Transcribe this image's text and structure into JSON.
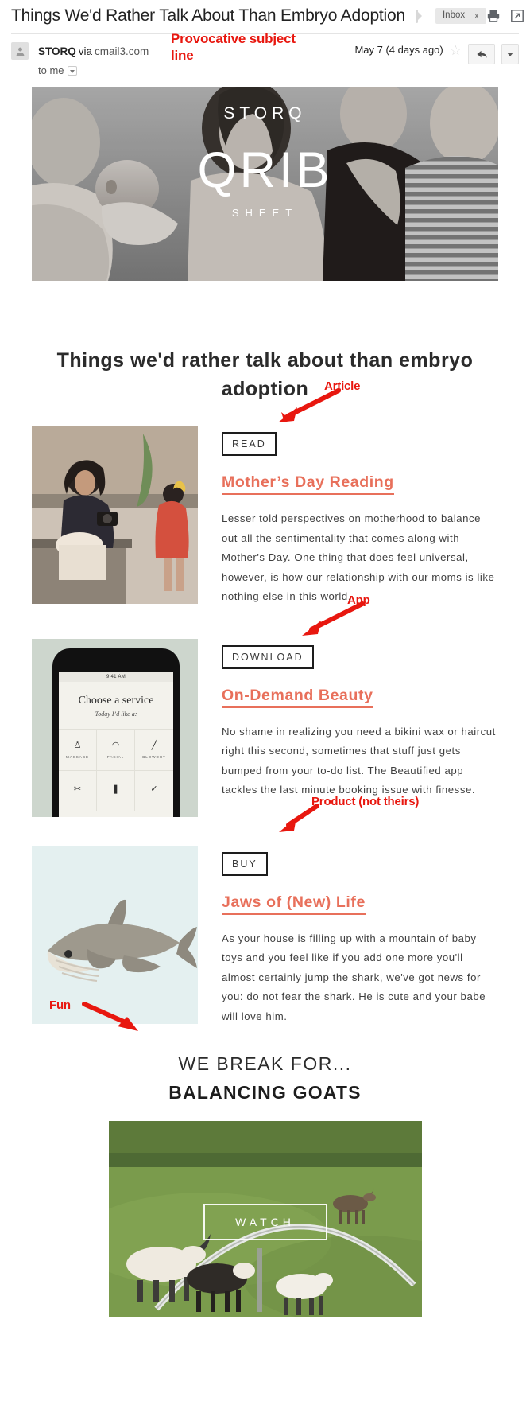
{
  "gmail": {
    "subject": "Things We'd Rather Talk About Than Embryo Adoption",
    "label_chip": "Inbox",
    "label_chip_close": "x",
    "print_icon": "print-icon",
    "popout_icon": "open-in-new-window-icon",
    "sender_name": "STORQ",
    "via_word": "via",
    "via_domain": "cmail3.com",
    "to_me": "to me",
    "date": "May 7 (4 days ago)",
    "star_glyph": "☆",
    "reply_icon": "reply-arrow-icon",
    "more_icon": "more-options-caret-icon",
    "avatar_icon": "contact-avatar-icon"
  },
  "annotations": {
    "subject": "Provocative subject line",
    "article": "Article",
    "app": "App",
    "product": "Product (not theirs)",
    "fun": "Fun",
    "color": "#e8170f"
  },
  "hero": {
    "brand": "STORQ",
    "title": "QRIB",
    "subtitle": "SHEET"
  },
  "newsletter": {
    "heading": "Things we'd rather talk about than embryo adoption",
    "accent_color": "#e8705b",
    "sections": [
      {
        "cta": "READ",
        "title": "Mother’s Day Reading",
        "text": "Lesser told perspectives on motherhood to balance out all the sentimentality that comes along with Mother's Day. One thing that does feel universal, however, is how our relationship with our moms is like nothing else in this world.",
        "thumb": "mother-and-daughter-photo"
      },
      {
        "cta": "DOWNLOAD",
        "title": "On-Demand Beauty",
        "text": "No shame in realizing you need a bikini wax or haircut right this second, sometimes that stuff just gets bumped from your to-do list. The Beautified app tackles the last minute booking issue with finesse.",
        "thumb": "iphone-app-screenshot"
      },
      {
        "cta": "BUY",
        "title": "Jaws of (New) Life",
        "text": "As your house is filling up with a mountain of baby toys and you feel like if you add one more you'll almost certainly jump the shark, we've got news for you: do not fear the shark. He is cute and your babe will love him.",
        "thumb": "plush-shark-toy-photo"
      }
    ],
    "phone_mock": {
      "status_time": "9:41 AM",
      "heading": "Choose a service",
      "subheading": "Today I’d like a:",
      "services": [
        {
          "label": "MASSAGE",
          "glyph": "♙"
        },
        {
          "label": "FACIAL",
          "glyph": "◠"
        },
        {
          "label": "BLOWOUT",
          "glyph": "╱"
        },
        {
          "label": "",
          "glyph": "✂"
        },
        {
          "label": "",
          "glyph": "❚"
        },
        {
          "label": "",
          "glyph": "✓"
        }
      ]
    },
    "break": {
      "line1": "WE BREAK FOR...",
      "line2": "BALANCING GOATS",
      "watch_label": "WATCH",
      "video_thumb": "goats-balancing-on-ribbon-video"
    }
  }
}
